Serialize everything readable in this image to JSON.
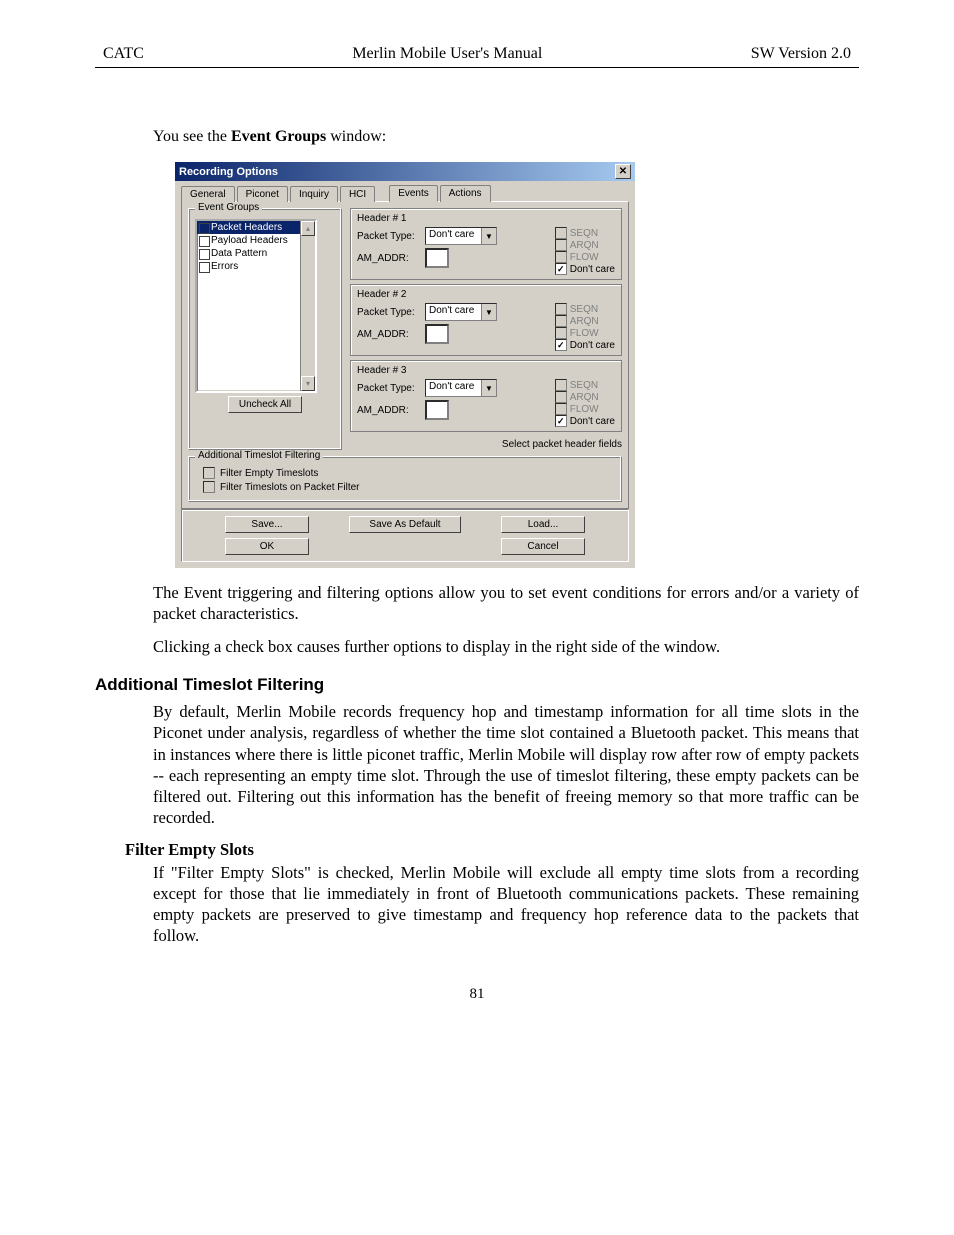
{
  "page": {
    "header_left": "CATC",
    "header_center": "Merlin Mobile User's Manual",
    "header_right": "SW Version 2.0",
    "number": "81"
  },
  "text": {
    "intro_pre": "You see the ",
    "intro_bold": "Event Groups",
    "intro_post": " window:",
    "p1": "The Event triggering and filtering options allow you to set event conditions for errors and/or a variety of packet characteristics.",
    "p2": "Clicking a check box causes further options to display in the right side of the window.",
    "h_additional": "Additional Timeslot Filtering",
    "p3": "By default, Merlin Mobile records frequency hop and timestamp information for all time slots in the Piconet under analysis, regardless of whether the time slot contained a Bluetooth packet.  This means that in instances where there is little piconet traffic, Merlin Mobile will display row after row of empty packets -- each representing an empty time slot.  Through the use of timeslot filtering, these empty packets can be filtered out.  Filtering out this information has the benefit of freeing memory so that more traffic can be recorded.",
    "sub1": "Filter Empty Slots",
    "p4": "If  \"Filter Empty Slots\" is checked, Merlin Mobile will exclude all empty time slots from a recording except for those that lie immediately in front of Bluetooth communications packets. These remaining empty packets are preserved to give timestamp and frequency hop reference data to the packets that follow."
  },
  "win": {
    "title": "Recording Options",
    "tabs_left": {
      "t0": "General",
      "t1": "Piconet",
      "t2": "Inquiry",
      "t3": "HCI"
    },
    "tabs_right": {
      "t0": "Events",
      "t1": "Actions"
    },
    "groups_legend": "Event Groups",
    "list": {
      "i0": "Packet Headers",
      "i1": "Payload Headers",
      "i2": "Data Pattern",
      "i3": "Errors"
    },
    "uncheck": "Uncheck All",
    "hdr": {
      "h1": "Header # 1",
      "h2": "Header # 2",
      "h3": "Header # 3",
      "pkt_type": "Packet Type:",
      "am_addr": "AM_ADDR:",
      "dont_care": "Don't care",
      "f_seqn": "SEQN",
      "f_arqn": "ARQN",
      "f_flow": "FLOW",
      "f_dc": "Don't care"
    },
    "select_fields": "Select packet header fields",
    "additional_legend": "Additional Timeslot Filtering",
    "cb1": "Filter Empty Timeslots",
    "cb2": "Filter Timeslots on Packet Filter",
    "btn": {
      "save": "Save...",
      "save_default": "Save As Default",
      "load": "Load...",
      "ok": "OK",
      "cancel": "Cancel"
    }
  }
}
